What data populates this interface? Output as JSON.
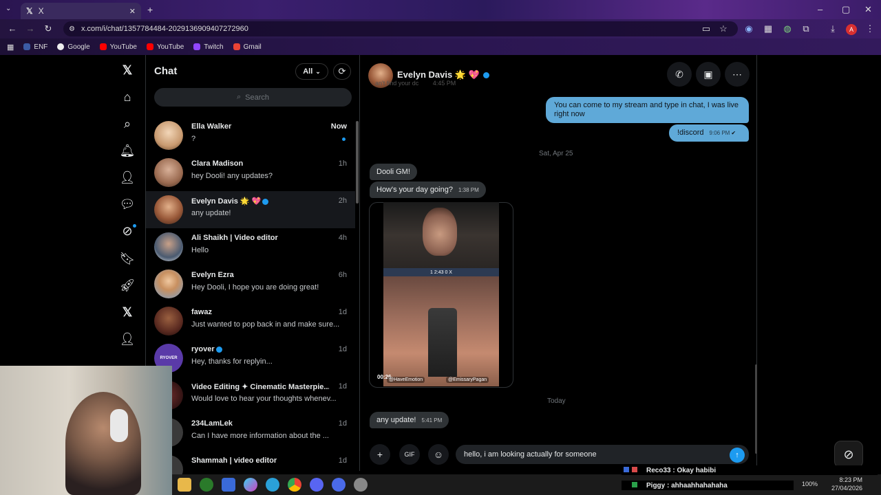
{
  "browser": {
    "tab_title": "X",
    "url": "x.com/i/chat/1357784484-2029136909407272960",
    "bookmarks": [
      {
        "label": "ENF",
        "color": "#3b5ba5"
      },
      {
        "label": "Google",
        "color": "#eeeeee"
      },
      {
        "label": "YouTube",
        "color": "#ff0000"
      },
      {
        "label": "YouTube",
        "color": "#ff0000"
      },
      {
        "label": "Twitch",
        "color": "#9146ff"
      },
      {
        "label": "Gmail",
        "color": "#ea4335"
      }
    ]
  },
  "chat_list": {
    "title": "Chat",
    "filter": "All",
    "search_placeholder": "Search",
    "rows": [
      {
        "name": "Ella Walker",
        "message": "?",
        "time": "Now",
        "avatar_color": "#d9b89a"
      },
      {
        "name": "Clara Madison",
        "message": "hey Dooli! any updates?",
        "time": "1h",
        "avatar_color": "#b88a70"
      },
      {
        "name": "Evelyn Davis 🌟 💖",
        "message": "any update!",
        "time": "2h",
        "avatar_color": "#a66a4a"
      },
      {
        "name": "Ali Shaikh | Video editor",
        "message": "Hello",
        "time": "4h",
        "avatar_color": "#4a6a8a"
      },
      {
        "name": "Evelyn Ezra",
        "message": "Hey Dooli, I hope you are doing great!",
        "time": "6h",
        "avatar_color": "#7aa0c8"
      },
      {
        "name": "fawaz",
        "message": "Just wanted to pop back in and make sure...",
        "time": "1d",
        "avatar_color": "#5a2a20"
      },
      {
        "name": "ryover",
        "message": "Hey, thanks for replyin...",
        "time": "1d",
        "avatar_color": "#5a3aa8"
      },
      {
        "name": "Video Editing ✦ Cinematic Masterpie...",
        "message": "Would love to hear your thoughts whenev...",
        "time": "1d",
        "avatar_color": "#2a1a1a"
      },
      {
        "name": "234LamLek",
        "message": "Can I have more information about the ...",
        "time": "1d",
        "avatar_color": "#3a3a3a"
      },
      {
        "name": "Shammah | video editor",
        "message": "",
        "time": "1d",
        "avatar_color": "#3a3a3a"
      }
    ]
  },
  "conversation": {
    "name": "Evelyn Davis 🌟 💖",
    "ghost_text": "an't find your dc",
    "ghost_time": "4:45 PM",
    "messages_out": [
      {
        "text": "You can come to my stream and type in chat, I was live right now"
      },
      {
        "text": "!discord",
        "time": "9:06 PM"
      }
    ],
    "date1": "Sat, Apr 25",
    "messages_in": [
      {
        "text": "Dooli GM!"
      },
      {
        "text": "How's your day going?",
        "time": "1:38 PM"
      }
    ],
    "media": {
      "duration": "00:26",
      "tag1": "@HaveEmotion",
      "tag2": "@EmissaryPagan",
      "hud": "1  2:43  0  X"
    },
    "date2": "Today",
    "last_in": {
      "text": "any update!",
      "time": "5:41 PM"
    },
    "composer_value": "hello, i am looking actually for someone"
  },
  "overlay": {
    "chat1": "Reco33 : Okay habibi",
    "chat2": "Piggy : ahhaahhahahaha",
    "battery": "100%",
    "clock_time": "8:23 PM",
    "clock_date": "27/04/2026"
  },
  "colors": {
    "accent": "#1d9bf0",
    "outgoing_bubble": "#5fa9d8",
    "incoming_bubble": "#2f3336"
  }
}
